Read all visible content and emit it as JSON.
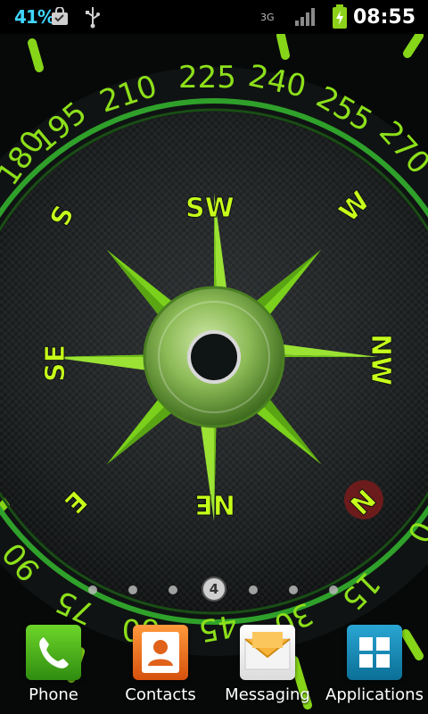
{
  "status_bar": {
    "battery_percent": "41%",
    "network_type": "3G",
    "time": "08:55",
    "icons": [
      "shopping-bag-icon",
      "usb-icon",
      "signal-icon",
      "battery-icon"
    ]
  },
  "compass": {
    "heading_labels": [
      "180",
      "195",
      "210",
      "225",
      "240",
      "255",
      "270",
      "90",
      "75",
      "60",
      "45",
      "30",
      "15",
      "0"
    ],
    "cardinal_labels": [
      "S",
      "SW",
      "W",
      "NW",
      "N",
      "NE",
      "E",
      "SE"
    ],
    "accent_color": "#8de01a",
    "north_marker_color": "#7a1b1b"
  },
  "home": {
    "current_page": "4",
    "page_dots": 7
  },
  "dock": {
    "items": [
      {
        "label": "Phone",
        "icon": "phone-icon"
      },
      {
        "label": "Contacts",
        "icon": "contacts-icon"
      },
      {
        "label": "Messaging",
        "icon": "messaging-icon"
      },
      {
        "label": "Applications",
        "icon": "apps-grid-icon"
      }
    ]
  }
}
